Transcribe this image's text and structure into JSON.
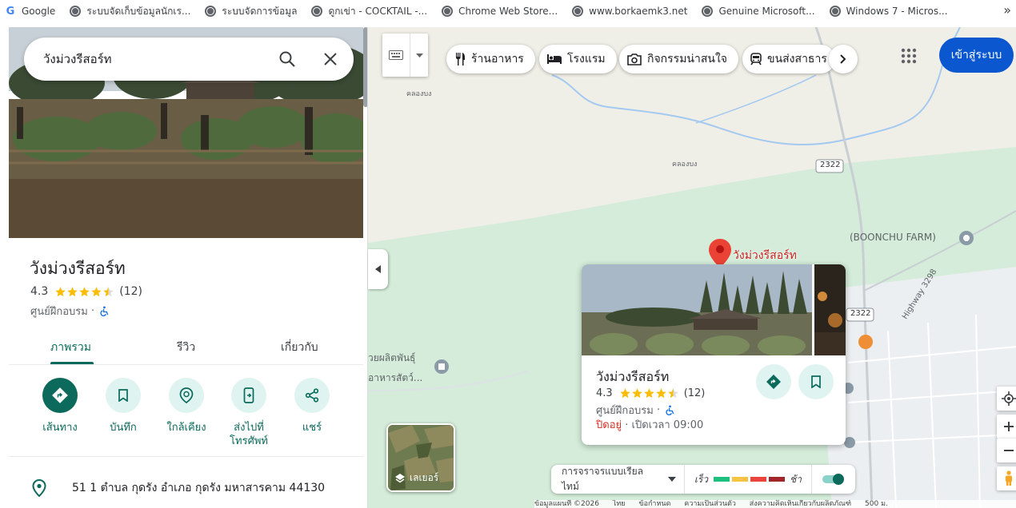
{
  "bookmarks": [
    {
      "label": "Google",
      "icon": "google-icon"
    },
    {
      "label": "ระบบจัดเก็บข้อมูลนักเร...",
      "icon": "globe-icon"
    },
    {
      "label": "ระบบจัดการข้อมูล",
      "icon": "globe-icon"
    },
    {
      "label": "ดูกเข่า - COCKTAIL -...",
      "icon": "globe-icon"
    },
    {
      "label": "Chrome Web Store...",
      "icon": "globe-icon"
    },
    {
      "label": "www.borkaemk3.net",
      "icon": "globe-icon"
    },
    {
      "label": "Genuine Microsoft...",
      "icon": "globe-icon"
    },
    {
      "label": "Windows 7 - Micros...",
      "icon": "globe-icon"
    }
  ],
  "bookmarks_more": "»",
  "search": {
    "query": "วังม่วงรีสอร์ท"
  },
  "place": {
    "name": "วังม่วงรีสอร์ท",
    "rating": "4.3",
    "rating_value": 4.3,
    "review_count": "(12)",
    "category": "ศูนย์ฝึกอบรม",
    "separator": "·",
    "address": "51 1 ตำบล กุดรัง อำเภอ กุดรัง มหาสารคาม 44130"
  },
  "tabs": [
    {
      "label": "ภาพรวม",
      "active": true
    },
    {
      "label": "รีวิว",
      "active": false
    },
    {
      "label": "เกี่ยวกับ",
      "active": false
    }
  ],
  "actions": [
    {
      "label": "เส้นทาง",
      "icon": "directions-icon"
    },
    {
      "label": "บันทึก",
      "icon": "bookmark-icon"
    },
    {
      "label": "ใกล้เคียง",
      "icon": "nearby-icon"
    },
    {
      "label": "ส่งไปที่\nโทรศัพท์",
      "icon": "send-to-phone-icon"
    },
    {
      "label": "แชร์",
      "icon": "share-icon"
    }
  ],
  "map": {
    "categories": [
      "ร้านอาหาร",
      "โรงแรม",
      "กิจกรรมน่าสนใจ",
      "ขนส่งสาธาร"
    ],
    "signin": "เข้าสู่ระบบ",
    "labels": {
      "river1": "คลองบง",
      "river2": "คลองบง",
      "road1": "2322",
      "road2": "2322",
      "boonchu": "(BOONCHU FARM)",
      "highway": "Highway 3298",
      "left1": "วยผลิตพันธุ์",
      "left2": "อาหารสัตว์..."
    },
    "marker_label": "วังม่วงรีสอร์ท",
    "card": {
      "name": "วังม่วงรีสอร์ท",
      "rating": "4.3",
      "review_count": "(12)",
      "category": "ศูนย์ฝึกอบรม",
      "status": "ปิดอยู่",
      "opens": "· เปิดเวลา 09:00"
    },
    "layers_label": "เลเยอร์",
    "traffic": {
      "mode": "การจราจรแบบเรียลไทม์",
      "fast": "เร็ว",
      "slow": "ช้า",
      "colors": [
        "#1ec080",
        "#f6c343",
        "#e8453c",
        "#a1262a"
      ]
    },
    "footer": [
      "ข้อมูลแผนที่ ©2026",
      "ไทย",
      "ข้อกำหนด",
      "ความเป็นส่วนตัว",
      "ส่งความคิดเห็นเกี่ยวกับผลิตภัณฑ์",
      "500 ม."
    ]
  },
  "colors": {
    "accent": "#0b6a5b",
    "signin": "#0b57d0",
    "marker": "#ea4335"
  }
}
